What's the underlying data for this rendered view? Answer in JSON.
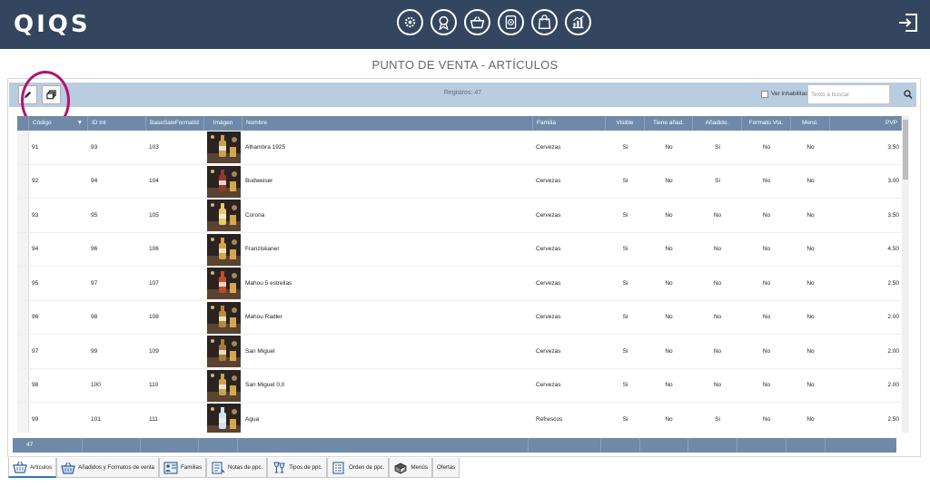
{
  "app": {
    "logo": "QIQS",
    "page_title": "PUNTO DE VENTA - ARTÍCULOS"
  },
  "nav": {
    "icons": [
      "gear-icon",
      "award-icon",
      "basket-icon",
      "fingerprint-icon",
      "shopping-bag-icon",
      "chart-icon"
    ],
    "logout_icon": "logout-icon"
  },
  "toolbar": {
    "records_label": "Registros: 47",
    "show_disabled_label": "Ver inhabilitados",
    "search_placeholder": "Texto a buscar"
  },
  "grid": {
    "columns": [
      "Código",
      "ID Int",
      "BaseSaleFormatId",
      "Imágen",
      "Nombre",
      "Familia",
      "Visible",
      "Tiene añad.",
      "Añadido.",
      "Formato Vta.",
      "Menú.",
      "PVP"
    ],
    "rows": [
      {
        "codigo": "91",
        "id_int": "93",
        "base": "103",
        "nombre": "Alhambra 1925",
        "familia": "Cervezas",
        "visible": "Si",
        "tiene": "No",
        "anadido": "Si",
        "formato": "No",
        "menu": "No",
        "pvp": "3.50"
      },
      {
        "codigo": "92",
        "id_int": "94",
        "base": "104",
        "nombre": "Budweiser",
        "familia": "Cervezas",
        "visible": "Si",
        "tiene": "No",
        "anadido": "Si",
        "formato": "No",
        "menu": "No",
        "pvp": "3.00"
      },
      {
        "codigo": "93",
        "id_int": "95",
        "base": "105",
        "nombre": "Corona",
        "familia": "Cervezas",
        "visible": "Si",
        "tiene": "No",
        "anadido": "No",
        "formato": "No",
        "menu": "No",
        "pvp": "3.50"
      },
      {
        "codigo": "94",
        "id_int": "96",
        "base": "106",
        "nombre": "Franziskaner",
        "familia": "Cervezas",
        "visible": "Si",
        "tiene": "No",
        "anadido": "No",
        "formato": "No",
        "menu": "No",
        "pvp": "4.50"
      },
      {
        "codigo": "95",
        "id_int": "97",
        "base": "107",
        "nombre": "Mahou 5 estrellas",
        "familia": "Cervezas",
        "visible": "Si",
        "tiene": "No",
        "anadido": "No",
        "formato": "No",
        "menu": "No",
        "pvp": "2.50"
      },
      {
        "codigo": "96",
        "id_int": "98",
        "base": "108",
        "nombre": "Mahou Radler",
        "familia": "Cervezas",
        "visible": "Si",
        "tiene": "No",
        "anadido": "No",
        "formato": "No",
        "menu": "No",
        "pvp": "2.00"
      },
      {
        "codigo": "97",
        "id_int": "99",
        "base": "109",
        "nombre": "San Miguel",
        "familia": "Cervezas",
        "visible": "Si",
        "tiene": "No",
        "anadido": "No",
        "formato": "No",
        "menu": "No",
        "pvp": "2.00"
      },
      {
        "codigo": "98",
        "id_int": "100",
        "base": "110",
        "nombre": "San Miguel 0,0",
        "familia": "Cervezas",
        "visible": "Si",
        "tiene": "No",
        "anadido": "No",
        "formato": "No",
        "menu": "No",
        "pvp": "2.00"
      },
      {
        "codigo": "99",
        "id_int": "101",
        "base": "111",
        "nombre": "Agua",
        "familia": "Refrescos",
        "visible": "Si",
        "tiene": "No",
        "anadido": "Si",
        "formato": "No",
        "menu": "No",
        "pvp": "2.50"
      }
    ],
    "footer_count": "47"
  },
  "tabs": [
    {
      "label": "Artículos",
      "icon": "basket-icon",
      "active": true
    },
    {
      "label": "Añadidos y Formatos de venta",
      "icon": "basket-icon"
    },
    {
      "label": "Familias",
      "icon": "family-icon"
    },
    {
      "label": "Notas de ppc.",
      "icon": "notes-icon"
    },
    {
      "label": "Tipos de ppc.",
      "icon": "wine-icon"
    },
    {
      "label": "Orden de ppc.",
      "icon": "order-icon"
    },
    {
      "label": "Menús",
      "icon": "menu-icon"
    },
    {
      "label": "Ofertas",
      "icon": ""
    }
  ],
  "colors": {
    "topbar": "#33455f",
    "toolbar": "#b9cde0",
    "grid_header": "#6f8aa8",
    "annotation": "#b4136e"
  }
}
